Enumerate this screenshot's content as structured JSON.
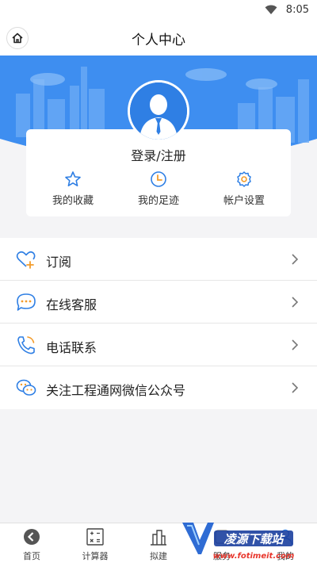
{
  "status_bar": {
    "time": "8:05"
  },
  "header": {
    "title": "个人中心"
  },
  "profile": {
    "login_label": "登录/注册",
    "quick_links": [
      {
        "label": "我的收藏",
        "icon": "star-icon"
      },
      {
        "label": "我的足迹",
        "icon": "clock-icon"
      },
      {
        "label": "帐户设置",
        "icon": "gear-icon"
      }
    ]
  },
  "menu": {
    "items": [
      {
        "label": "订阅",
        "icon": "heart-plus-icon"
      },
      {
        "label": "在线客服",
        "icon": "chat-bubble-icon"
      },
      {
        "label": "电话联系",
        "icon": "phone-icon"
      },
      {
        "label": "关注工程通网微信公众号",
        "icon": "wechat-icon"
      }
    ]
  },
  "tabbar": {
    "items": [
      {
        "label": "首页",
        "icon": "back-arrow-icon"
      },
      {
        "label": "计算器",
        "icon": "calculator-icon"
      },
      {
        "label": "拟建",
        "icon": "building-icon"
      },
      {
        "label": "服务",
        "icon": "service-icon"
      },
      {
        "label": "我的",
        "icon": "user-icon"
      }
    ]
  },
  "watermark": {
    "title": "凌源下载站",
    "url": "www.fotimeit.com"
  },
  "colors": {
    "accent": "#2f7fe4",
    "hero": "#3e8ef0",
    "icon_blue": "#2f7fe4",
    "icon_orange": "#f39c2b"
  }
}
